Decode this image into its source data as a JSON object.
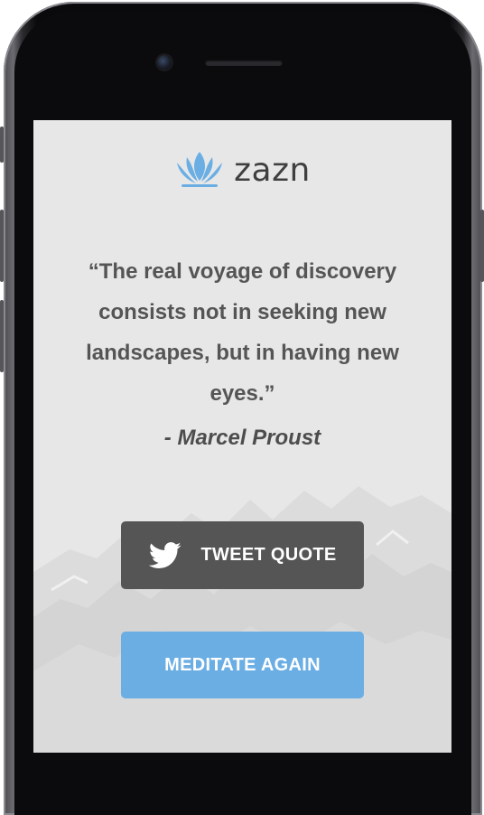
{
  "app": {
    "logo_text": "zazn"
  },
  "quote": {
    "text": "“The real voyage of discovery consists not in seeking new landscapes, but in having new eyes.”",
    "author": "- Marcel Proust"
  },
  "buttons": {
    "tweet_label": "TWEET QUOTE",
    "meditate_label": "MEDITATE AGAIN"
  },
  "colors": {
    "accent": "#6aaee4",
    "tweet_button": "#555555",
    "screen_background": "#e7e7e7",
    "text": "#555555"
  },
  "icons": {
    "logo": "lotus-icon",
    "tweet": "twitter-bird-icon"
  }
}
